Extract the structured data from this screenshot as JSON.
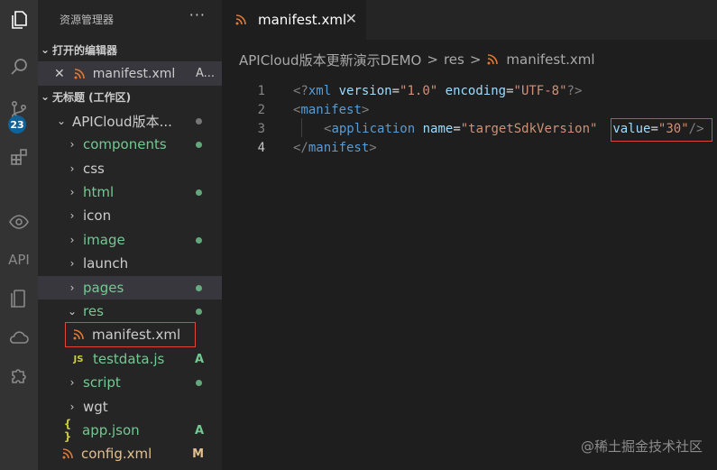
{
  "sidebar": {
    "title": "资源管理器",
    "more": "···",
    "open_editors_label": "打开的编辑器",
    "open_editor": {
      "close": "✕",
      "name": "manifest.xml",
      "suffix": "A..."
    },
    "workspace_label": "无标题 (工作区)",
    "tree": [
      {
        "name": "APICloud版本...",
        "status": "dot-gray"
      },
      {
        "name": "components",
        "status": "dot"
      },
      {
        "name": "css",
        "status": ""
      },
      {
        "name": "html",
        "status": "dot"
      },
      {
        "name": "icon",
        "status": ""
      },
      {
        "name": "image",
        "status": "dot"
      },
      {
        "name": "launch",
        "status": ""
      },
      {
        "name": "pages",
        "status": "dot"
      },
      {
        "name": "res",
        "status": "dot"
      },
      {
        "name": "manifest.xml",
        "status": ""
      },
      {
        "name": "testdata.js",
        "status": "A"
      },
      {
        "name": "script",
        "status": "dot"
      },
      {
        "name": "wgt",
        "status": ""
      },
      {
        "name": "app.json",
        "status": "A"
      },
      {
        "name": "config.xml",
        "status": "M"
      }
    ],
    "js_icon": "JS",
    "json_icon": "{ }"
  },
  "activity": {
    "badge": "23",
    "api": "API"
  },
  "tab": {
    "name": "manifest.xml",
    "close": "✕"
  },
  "breadcrumb": {
    "root": "APICloud版本更新演示DEMO",
    "sep": ">",
    "folder": "res",
    "file": "manifest.xml"
  },
  "editor": {
    "line_numbers": [
      "1",
      "2",
      "3",
      "4"
    ],
    "line1": {
      "open": "<?",
      "tag": "xml",
      "a1": "version",
      "v1": "\"1.0\"",
      "a2": "encoding",
      "v2": "\"UTF-8\"",
      "close": "?>"
    },
    "line2": {
      "open": "<",
      "tag": "manifest",
      "close": ">"
    },
    "line3": {
      "open": "<",
      "tag": "application",
      "a1": "name",
      "v1": "\"targetSdkVersion\"",
      "a2": "value",
      "v2": "\"30\"",
      "close": "/>"
    },
    "line4": {
      "open": "</",
      "tag": "manifest",
      "close": ">"
    },
    "eq": "="
  },
  "watermark": "@稀土掘金技术社区",
  "colors": {
    "highlight_box": "#e0453a",
    "accent": "#0e639c",
    "git_added": "#73c991",
    "rss_icon": "#e37933"
  }
}
